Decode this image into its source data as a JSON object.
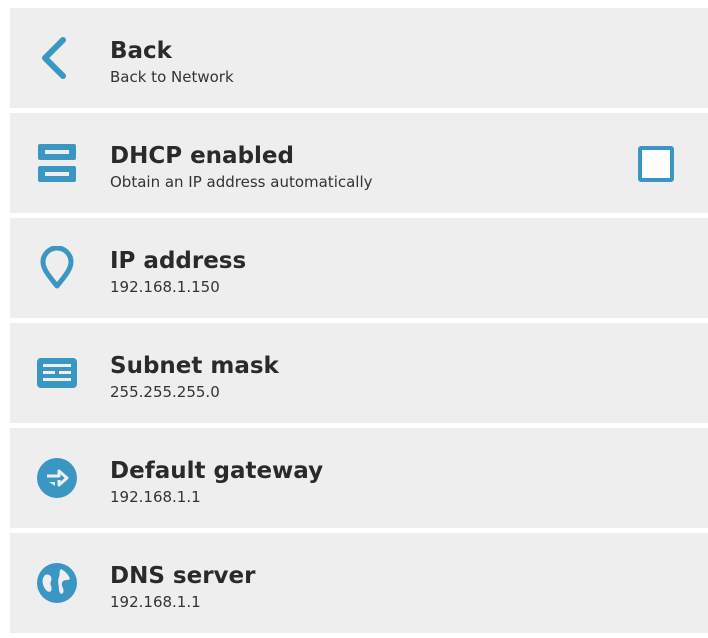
{
  "accent_color": "#3a96c3",
  "rows": [
    {
      "icon": "back-chevron-icon",
      "title": "Back",
      "subtitle": "Back to Network"
    },
    {
      "icon": "dhcp-server-icon",
      "title": "DHCP enabled",
      "subtitle": "Obtain an IP address automatically",
      "checkbox_checked": false
    },
    {
      "icon": "location-pin-icon",
      "title": "IP address",
      "subtitle": "192.168.1.150"
    },
    {
      "icon": "subnet-mask-icon",
      "title": "Subnet mask",
      "subtitle": "255.255.255.0"
    },
    {
      "icon": "gateway-arrows-icon",
      "title": "Default gateway",
      "subtitle": "192.168.1.1"
    },
    {
      "icon": "globe-icon",
      "title": "DNS server",
      "subtitle": "192.168.1.1"
    }
  ]
}
